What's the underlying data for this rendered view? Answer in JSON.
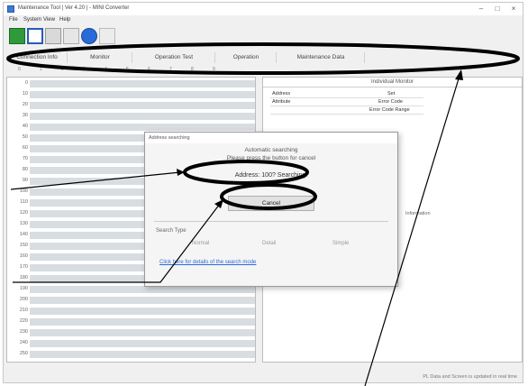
{
  "window": {
    "title": "Maintenance Tool | Ver 4.20 | - MINI Converter",
    "controls": {
      "minimize": "–",
      "maximize": "□",
      "close": "×"
    }
  },
  "menu": {
    "items": [
      "File",
      "System",
      "View",
      "Help"
    ]
  },
  "toolbar": {
    "icons": [
      "new-icon",
      "save-icon",
      "open-icon",
      "print-icon",
      "help-icon",
      "info-icon"
    ]
  },
  "tabs": [
    {
      "label": "Connection Info"
    },
    {
      "label": "Monitor"
    },
    {
      "label": "Operation Test"
    },
    {
      "label": "Operation"
    },
    {
      "label": "Maintenance Data"
    }
  ],
  "grid": {
    "col_headers": [
      "0",
      "1",
      "2",
      "3",
      "4",
      "5",
      "6",
      "7",
      "8",
      "9"
    ],
    "rows": [
      "0",
      "10",
      "20",
      "30",
      "40",
      "50",
      "60",
      "70",
      "80",
      "90",
      "100",
      "110",
      "120",
      "130",
      "140",
      "150",
      "160",
      "170",
      "180",
      "190",
      "200",
      "210",
      "220",
      "230",
      "240",
      "250"
    ]
  },
  "right_panel": {
    "header": "Individual Monitor",
    "rows": [
      {
        "label": "Address",
        "value": "",
        "extra": "Set"
      },
      {
        "label": "Attribute",
        "value": "",
        "extra": "Error Code"
      },
      {
        "label": "",
        "value": "",
        "extra": "Error Code  Range"
      }
    ],
    "side_label": "Information"
  },
  "status_bar": {
    "text": "PL Data and Screen is updated in real time"
  },
  "dialog": {
    "title": "Address searching",
    "message_line1": "Automatic searching",
    "message_line2": "Please press the button for cancel",
    "address_text": "Address: 100?   Searching!",
    "cancel_label": "Cancel",
    "search_type_title": "Search Type",
    "search_options": [
      "Normal",
      "Detail",
      "Simple"
    ],
    "link_text": "Click here for details of the search mode"
  }
}
